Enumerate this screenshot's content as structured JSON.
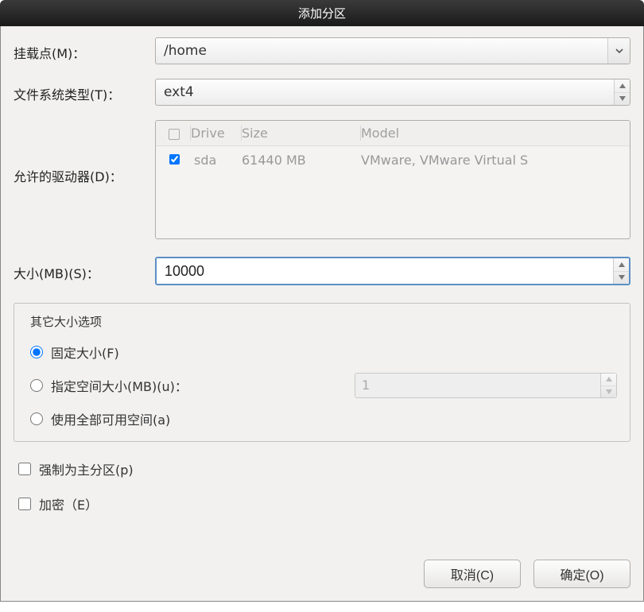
{
  "dialog": {
    "title": "添加分区"
  },
  "labels": {
    "mount_point": "挂载点(M)：",
    "fs_type": "文件系统类型(T)：",
    "allowed_drives": "允许的驱动器(D)：",
    "size_mb": "大小(MB)(S)："
  },
  "mount_point": {
    "value": "/home"
  },
  "fs_type": {
    "value": "ext4"
  },
  "drives": {
    "headers": {
      "check": "O",
      "drive": "Drive",
      "size": "Size",
      "model": "Model"
    },
    "rows": [
      {
        "checked": true,
        "drive": "sda",
        "size": "61440 MB",
        "model": "VMware, VMware Virtual S"
      }
    ]
  },
  "size": {
    "value": "10000"
  },
  "size_options": {
    "legend": "其它大小选项",
    "fixed": {
      "label": "固定大小(F)",
      "selected": true
    },
    "fill_up_to": {
      "label": "指定空间大小(MB)(u)：",
      "selected": false,
      "value": "1"
    },
    "all_space": {
      "label": "使用全部可用空间(a)",
      "selected": false
    }
  },
  "checks": {
    "primary": {
      "label": "强制为主分区(p)",
      "checked": false
    },
    "encrypt": {
      "label": "加密（E）",
      "checked": false
    }
  },
  "buttons": {
    "cancel": "取消(C)",
    "ok": "确定(O)"
  }
}
